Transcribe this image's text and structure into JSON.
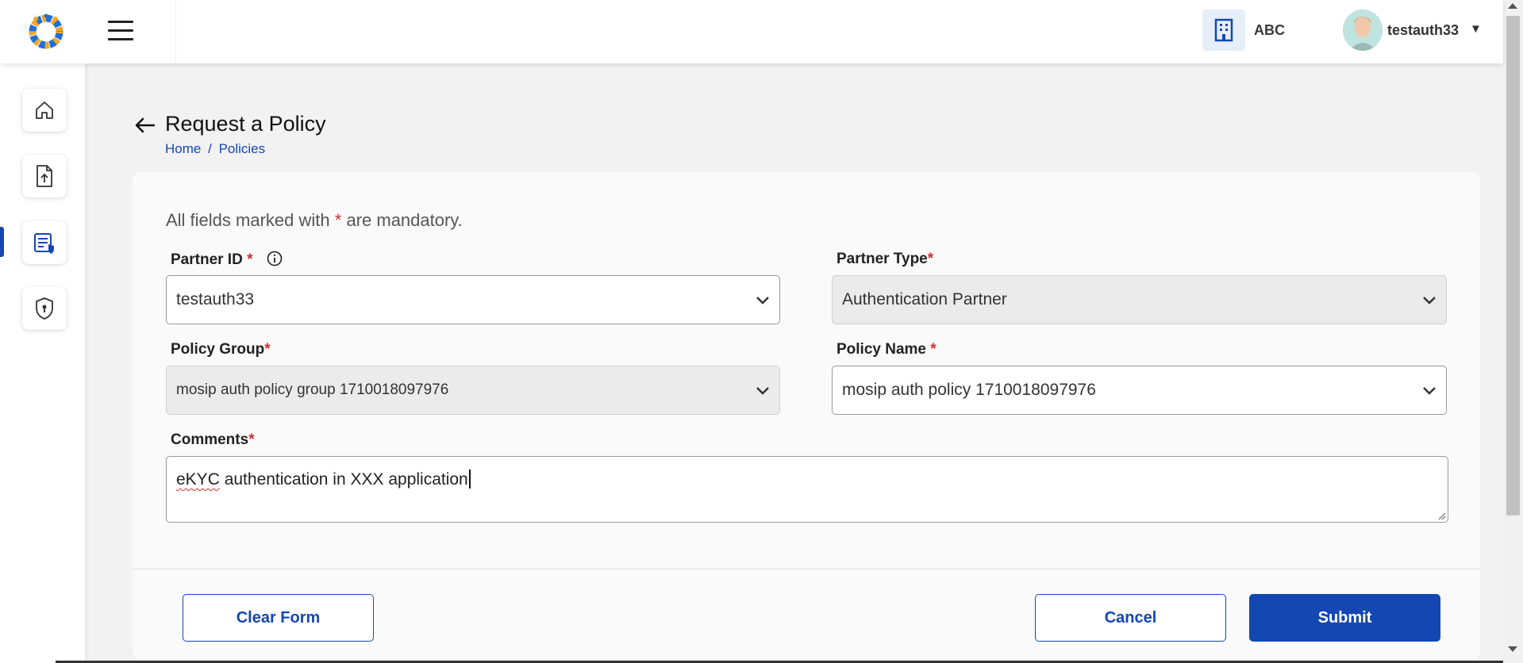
{
  "header": {
    "org_name": "ABC",
    "user_name": "testauth33",
    "icons": [
      "app-logo-icon",
      "hamburger-menu-icon",
      "building-icon",
      "user-avatar",
      "caret-down-icon"
    ]
  },
  "sidebar": {
    "items": [
      {
        "name": "home",
        "icon": "home-icon"
      },
      {
        "name": "upload",
        "icon": "file-upload-icon"
      },
      {
        "name": "policies",
        "icon": "policy-document-icon",
        "active": true
      },
      {
        "name": "security",
        "icon": "shield-icon"
      }
    ]
  },
  "page": {
    "title": "Request a Policy",
    "breadcrumb": {
      "home": "Home",
      "separator": "/",
      "current": "Policies"
    }
  },
  "form": {
    "mandatory_prefix": "All fields marked with",
    "mandatory_star": "*",
    "mandatory_suffix": "are mandatory.",
    "partner_id": {
      "label": "Partner ID",
      "value": "testauth33"
    },
    "partner_type": {
      "label": "Partner Type",
      "value": "Authentication Partner",
      "disabled": true
    },
    "policy_group": {
      "label": "Policy Group",
      "value": "mosip auth policy group 1710018097976",
      "disabled": true
    },
    "policy_name": {
      "label": "Policy Name",
      "value": "mosip auth policy 1710018097976"
    },
    "comments": {
      "label": "Comments",
      "value_misspelled": "eKYC",
      "value_rest": " authentication in XXX application"
    }
  },
  "buttons": {
    "clear": "Clear Form",
    "cancel": "Cancel",
    "submit": "Submit"
  },
  "colors": {
    "primary": "#1447b2",
    "required": "#d32f2f",
    "background": "#f2f2f2"
  }
}
